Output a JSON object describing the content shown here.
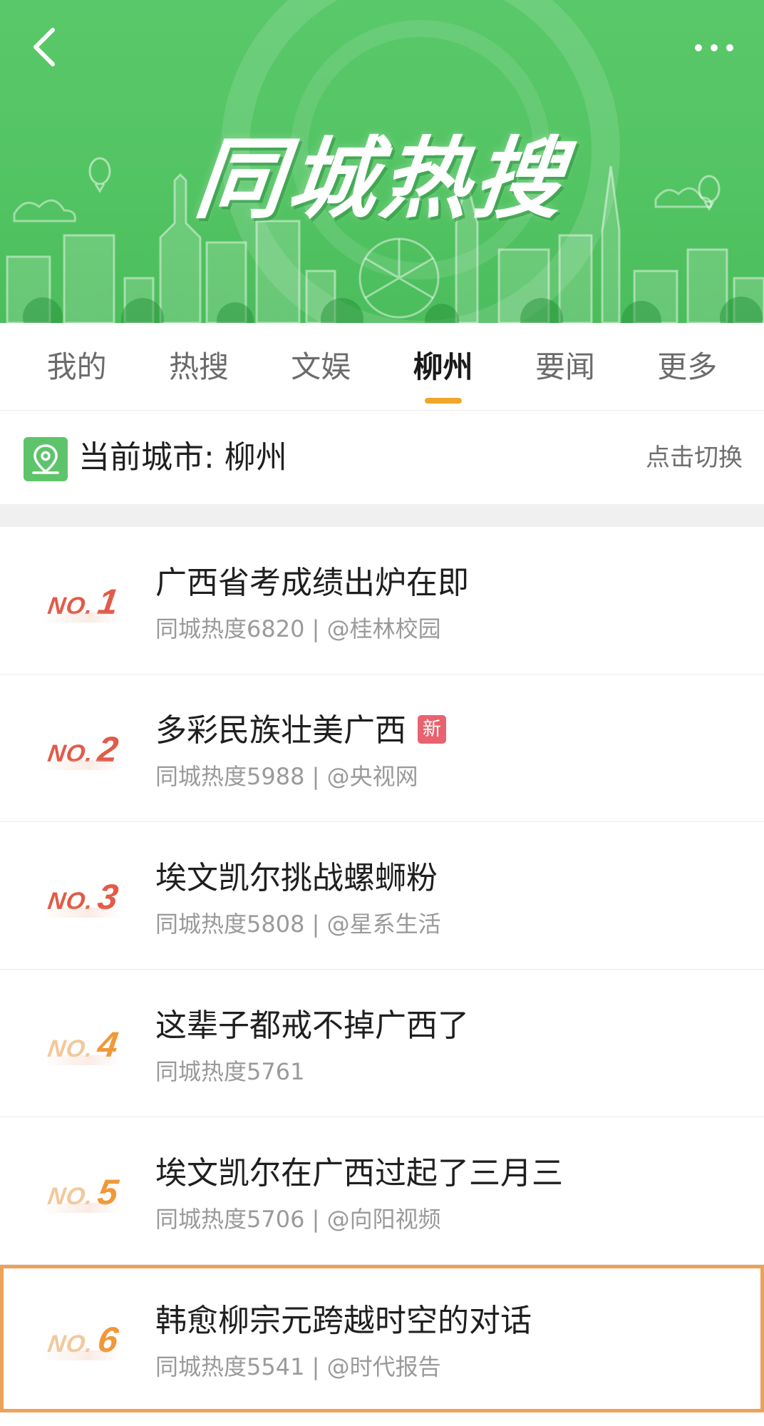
{
  "header": {
    "title": "同城热搜",
    "back_icon": "chevron-left-icon",
    "more_icon": "more-horizontal-icon"
  },
  "tabs": [
    {
      "label": "我的",
      "active": false
    },
    {
      "label": "热搜",
      "active": false
    },
    {
      "label": "文娱",
      "active": false
    },
    {
      "label": "柳州",
      "active": true
    },
    {
      "label": "要闻",
      "active": false
    },
    {
      "label": "更多",
      "active": false
    }
  ],
  "city_bar": {
    "label": "当前城市: 柳州",
    "switch_label": "点击切换",
    "icon": "location-icon"
  },
  "colors": {
    "banner_green": "#55c566",
    "tab_accent": "#f0a62a",
    "rank_red": "#e25b48",
    "rank_orange": "#f0983a",
    "highlight_border": "#eda258",
    "new_badge": "#e8636f"
  },
  "list": [
    {
      "rank_prefix": "NO.",
      "rank": "1",
      "title": "广西省考成绩出炉在即",
      "meta": "同城热度6820 | @桂林校园",
      "badge": ""
    },
    {
      "rank_prefix": "NO.",
      "rank": "2",
      "title": "多彩民族壮美广西",
      "meta": "同城热度5988 | @央视网",
      "badge": "新"
    },
    {
      "rank_prefix": "NO.",
      "rank": "3",
      "title": "埃文凯尔挑战螺蛳粉",
      "meta": "同城热度5808 | @星系生活",
      "badge": ""
    },
    {
      "rank_prefix": "NO.",
      "rank": "4",
      "title": "这辈子都戒不掉广西了",
      "meta": "同城热度5761",
      "badge": ""
    },
    {
      "rank_prefix": "NO.",
      "rank": "5",
      "title": "埃文凯尔在广西过起了三月三",
      "meta": "同城热度5706 | @向阳视频",
      "badge": ""
    },
    {
      "rank_prefix": "NO.",
      "rank": "6",
      "title": "韩愈柳宗元跨越时空的对话",
      "meta": "同城热度5541 | @时代报告",
      "badge": ""
    }
  ]
}
